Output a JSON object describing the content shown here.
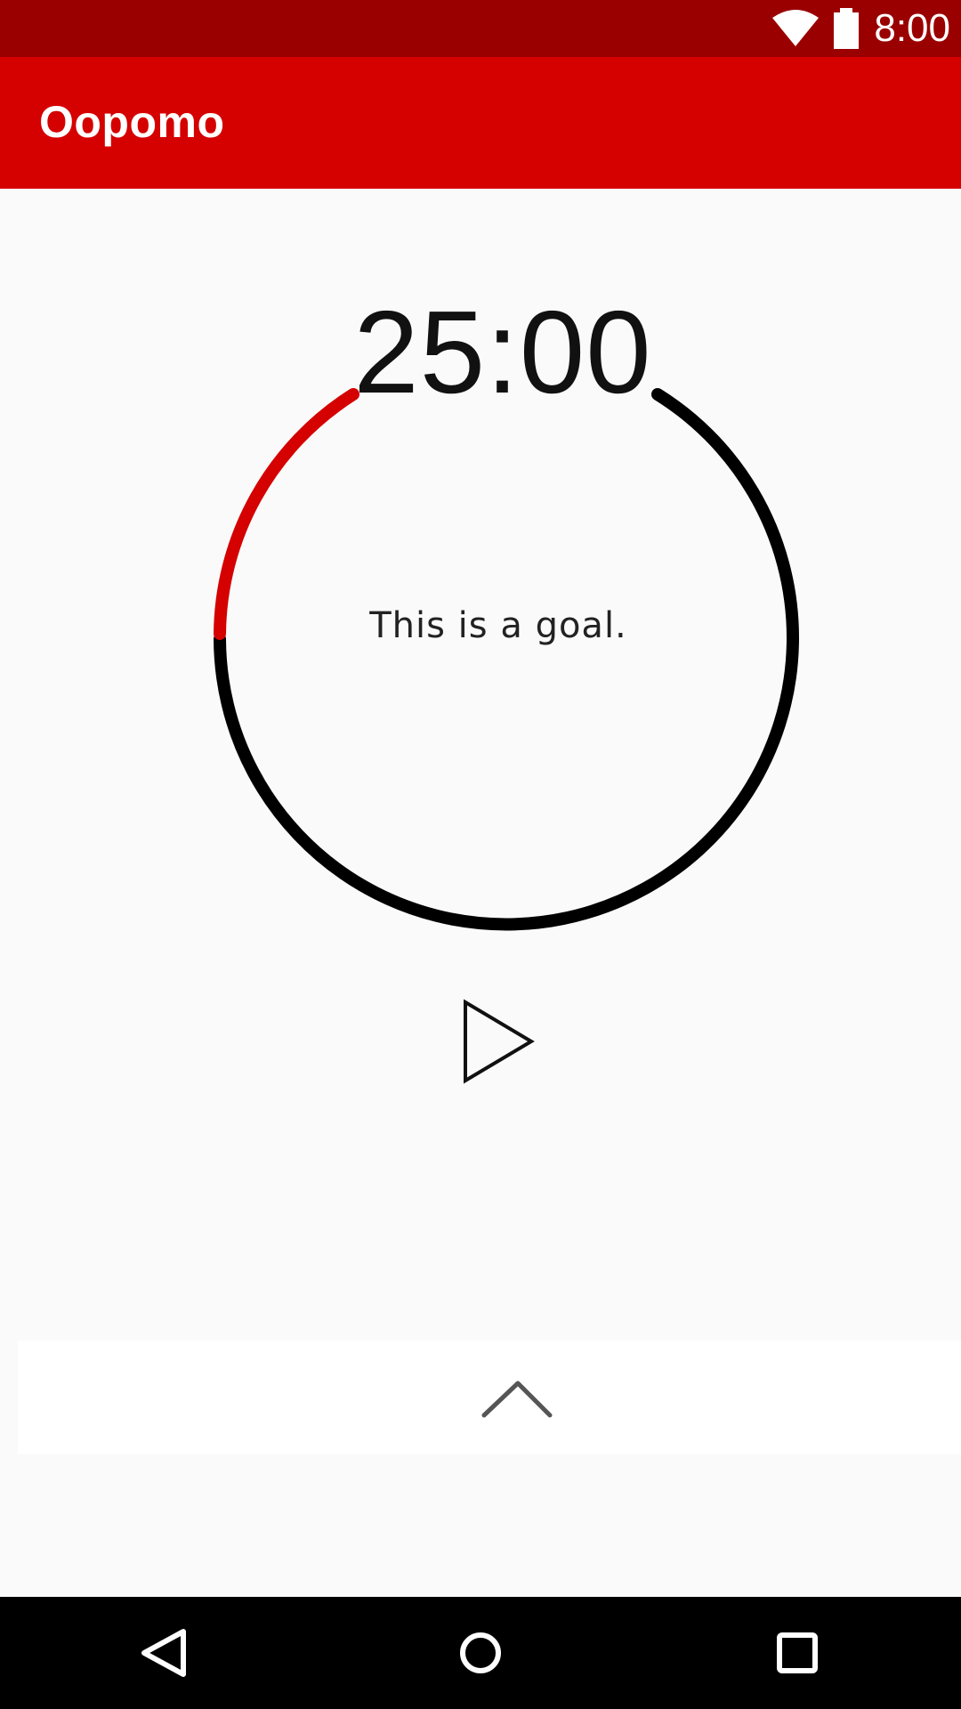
{
  "status_bar": {
    "time": "8:00",
    "icons": [
      "wifi-icon",
      "battery-icon"
    ],
    "color": "#9a0000"
  },
  "app_bar": {
    "title": "Oopomo",
    "color": "#d50000"
  },
  "timer": {
    "time": "25:00",
    "goal": "This is a goal.",
    "ring_accent_color": "#d50000",
    "ring_base_color": "#000000"
  },
  "controls": {
    "play_icon": "play-icon",
    "expand_icon": "chevron-up-icon"
  },
  "nav_bar": {
    "icons": [
      "back-icon",
      "home-icon",
      "recents-icon"
    ]
  }
}
